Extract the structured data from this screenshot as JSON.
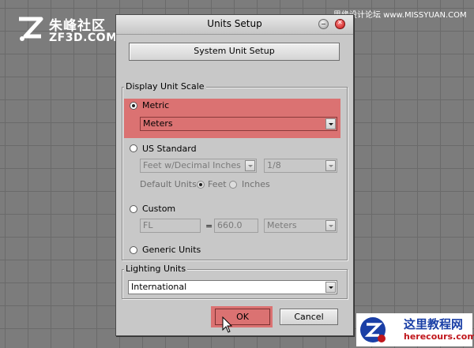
{
  "watermarks": {
    "top_left_cn": "朱峰社区",
    "top_left_en": "ZF3D.COM",
    "top_right": "思缘设计论坛 www.MISSYUAN.COM",
    "bottom_right_cn": "这里教程网",
    "bottom_right_en": "herecours.com"
  },
  "dialog": {
    "title": "Units Setup",
    "system_unit_setup_label": "System Unit Setup",
    "display_unit_scale": {
      "legend": "Display Unit Scale",
      "metric": {
        "label": "Metric",
        "selected": true,
        "value": "Meters"
      },
      "us_standard": {
        "label": "US Standard",
        "selected": false,
        "format_value": "Feet w/Decimal Inches",
        "fraction_value": "1/8",
        "default_units_label": "Default Units:",
        "feet_label": "Feet",
        "inches_label": "Inches"
      },
      "custom": {
        "label": "Custom",
        "selected": false,
        "name_value": "FL",
        "equals": "=",
        "amount_value": "660.0",
        "unit_value": "Meters"
      },
      "generic_units": {
        "label": "Generic Units",
        "selected": false
      }
    },
    "lighting_units": {
      "legend": "Lighting Units",
      "value": "International"
    },
    "ok_label": "OK",
    "cancel_label": "Cancel"
  },
  "colors": {
    "highlight": "#e25656",
    "dialog_bg": "#c8c8c8",
    "viewport_bg": "#7c7c7c"
  }
}
